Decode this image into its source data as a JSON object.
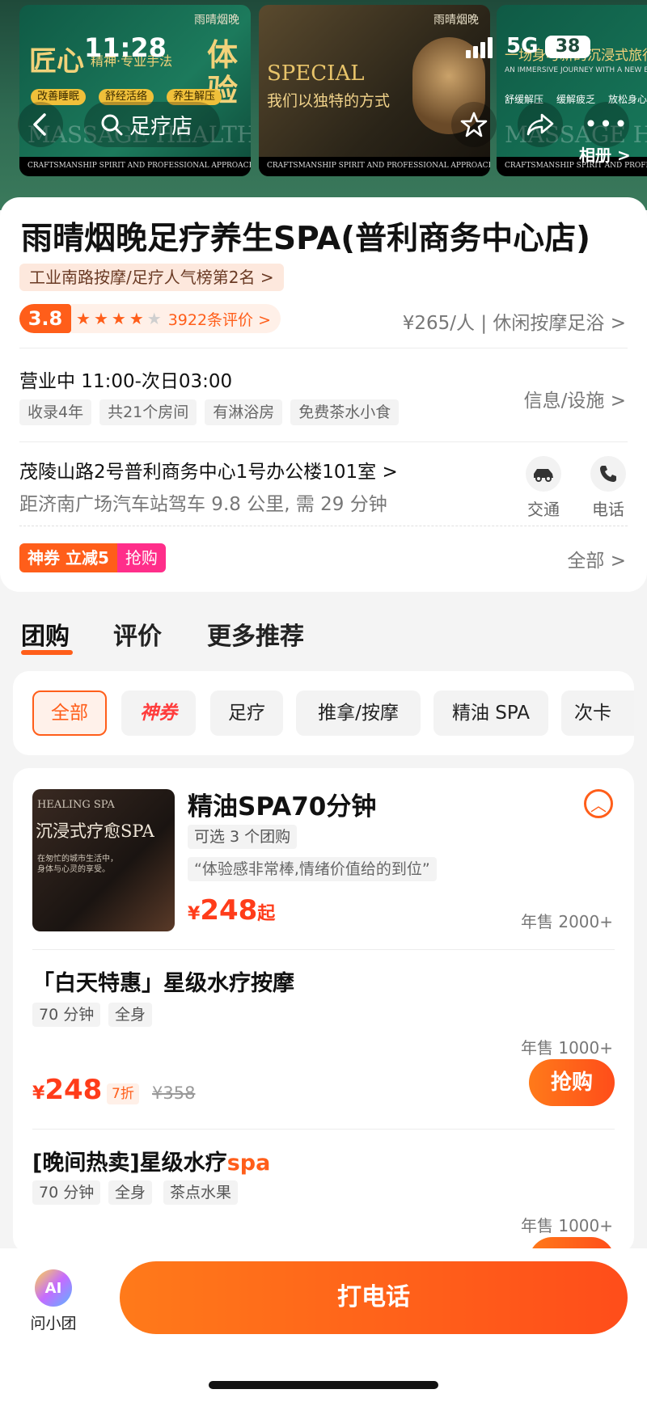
{
  "status_bar": {
    "time": "11:28",
    "network": "5G",
    "battery": "38"
  },
  "header": {
    "search_text": "足疗店",
    "album_label": "相册 >",
    "banner1": {
      "title_left": "匠心",
      "title_sub": "精神·专业手法",
      "title_right": "体验",
      "tags": [
        "改善睡眠",
        "舒经活络",
        "养生解压"
      ],
      "watermark": "MASSAGE HEALTH",
      "footer": "CRAFTSMANSHIP SPIRIT AND PROFESSIONAL APPROACH",
      "brand": "雨晴烟晚"
    },
    "banner2": {
      "en": "SPECIAL",
      "cn": "我们以独特的方式",
      "footer": "CRAFTSMANSHIP SPIRIT AND PROFESSIONAL APPROACH",
      "brand": "雨晴烟晚"
    },
    "banner3": {
      "title": "一场身与新的沉浸式旅行",
      "sub": "AN IMMERSIVE JOURNEY WITH A NEW EXPERIENCE",
      "tags": [
        "舒缓解压",
        "缓解疲乏",
        "放松身心"
      ],
      "watermark": "MASSAGE H",
      "footer": "CRAFTSMANSHIP SPIRIT AND PROFESSIONAL APPROACH"
    }
  },
  "shop": {
    "name": "雨晴烟晚足疗养生SPA(普利商务中心店)",
    "rank": "工业南路按摩/足疗人气榜第2名 >",
    "score": "3.8",
    "stars": 4,
    "review_count": "3922条评价 >",
    "price_category": "¥265/人 | 休闲按摩足浴 >",
    "hours": "营业中 11:00-次日03:00",
    "hour_tags": [
      "收录4年",
      "共21个房间",
      "有淋浴房",
      "免费茶水小食"
    ],
    "facilities_label": "信息/设施 >",
    "address": "茂陵山路2号普利商务中心1号办公楼101室 >",
    "distance": "距济南广场汽车站驾车 9.8 公里, 需 29 分钟",
    "transport_label": "交通",
    "phone_label": "电话",
    "coupon_main": "神券 立减5",
    "coupon_action": "抢购",
    "all_label": "全部 >"
  },
  "tabs": [
    "团购",
    "评价",
    "更多推荐"
  ],
  "filter_chips": [
    "全部",
    "神券",
    "足疗",
    "推拿/按摩",
    "精油 SPA",
    "次卡"
  ],
  "deal_group": {
    "thumb_en": "HEALING SPA",
    "thumb_cn": "沉浸式疗愈SPA",
    "thumb_desc": "在匆忙的城市生活中，身体与心灵的享受。",
    "title": "精油SPA70分钟",
    "option_tag": "可选 3 个团购",
    "quote": "“体验感非常棒,情绪价值给的到位”",
    "price_symbol": "¥",
    "price": "248",
    "price_suffix": "起",
    "sold": "年售 2000+"
  },
  "deal_items": [
    {
      "title": "「白天特惠」星级水疗按摩",
      "tags": [
        "70 分钟",
        "全身"
      ],
      "sold": "年售 1000+",
      "price_symbol": "¥",
      "price": "248",
      "discount": "7折",
      "original": "¥358",
      "buy_label": "抢购"
    },
    {
      "title": "[晚间热卖]星级水疗",
      "title_highlight": "spa",
      "tags": [
        "70 分钟",
        "全身",
        "茶点水果"
      ],
      "sold": "年售 1000+"
    }
  ],
  "bottom": {
    "ask_label": "问小团",
    "ask_badge": "AI",
    "call_label": "打电话"
  }
}
